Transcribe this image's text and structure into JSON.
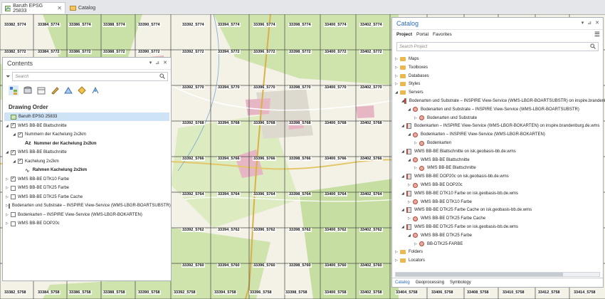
{
  "tabs": [
    {
      "label": "Baruth EPSG 25833",
      "active": true,
      "closable": true
    },
    {
      "label": "Catalog",
      "active": false,
      "closable": false
    }
  ],
  "map": {
    "tile_labels": [
      "33382_5774",
      "33384_5774",
      "33386_5774",
      "33388_5774",
      "33390_5774",
      "33392_5774",
      "33394_5774",
      "33396_5774",
      "33398_5774",
      "33400_5774",
      "33402_5774",
      "33382_5772",
      "33384_5772",
      "33386_5772",
      "33388_5772",
      "33390_5772",
      "33392_5772",
      "33394_5772",
      "33396_5772",
      "33398_5772",
      "33400_5772",
      "33402_5772",
      "33392_5770",
      "33394_5770",
      "33396_5770",
      "33398_5770",
      "33400_5770",
      "33402_5770",
      "33392_5768",
      "33394_5768",
      "33396_5768",
      "33398_5768",
      "33400_5768",
      "33402_5768",
      "33392_5766",
      "33394_5766",
      "33396_5766",
      "33398_5766",
      "33400_5766",
      "33402_5766",
      "33392_5764",
      "33394_5764",
      "33396_5764",
      "33398_5764",
      "33400_5764",
      "33402_5764",
      "33392_5762",
      "33394_5762",
      "33396_5762",
      "33398_5762",
      "33400_5762",
      "33402_5762",
      "33392_5760",
      "33394_5760",
      "33396_5760",
      "33398_5760",
      "33400_5760",
      "33402_5760",
      "33382_5758",
      "33384_5758",
      "33386_5758",
      "33388_5758",
      "33390_5758",
      "33392_5758",
      "33394_5758",
      "33396_5758",
      "33398_5758",
      "33400_5758",
      "33402_5758",
      "33404_5758",
      "33406_5758",
      "33408_5758",
      "33410_5758",
      "33412_5758",
      "33414_5758"
    ]
  },
  "contents": {
    "title": "Contents",
    "search_placeholder": "Search",
    "section": "Drawing Order",
    "items": [
      {
        "label": "Baruth EPSG 25833",
        "level": 0,
        "checkbox": "map",
        "expander": "",
        "selected": true
      },
      {
        "label": "WMS BB-BE Blattschnitte",
        "level": 0,
        "checkbox": "checked",
        "expander": "open"
      },
      {
        "label": "Nummern der Kachelung 2x2km",
        "level": 1,
        "checkbox": "checked",
        "expander": "open"
      },
      {
        "label": "Nummer der Kachelung 2x2km",
        "level": 2,
        "checkbox": "none",
        "expander": "",
        "symbol": "text"
      },
      {
        "label": "WMS BB-BE Blattschnitte",
        "level": 0,
        "checkbox": "checked",
        "expander": "open"
      },
      {
        "label": "Kachelung 2x2km",
        "level": 1,
        "checkbox": "checked",
        "expander": "open"
      },
      {
        "label": "Rahmen Kachelung 2x2km",
        "level": 2,
        "checkbox": "none",
        "expander": "",
        "symbol": "line"
      },
      {
        "label": "WMS BB-BE DTK10 Farbe",
        "level": 0,
        "checkbox": "checked",
        "expander": "closed"
      },
      {
        "label": "WMS BB-BE DTK25 Farbe",
        "level": 0,
        "checkbox": "unchecked",
        "expander": "closed"
      },
      {
        "label": "WMS BB-BE DTK25 Farbe Cache",
        "level": 0,
        "checkbox": "unchecked",
        "expander": "closed"
      },
      {
        "label": "Bodenarten und Substrate – INSPIRE View-Service (WMS-LBGR-BOARTSUBSTR)",
        "level": 0,
        "checkbox": "unchecked",
        "expander": "closed"
      },
      {
        "label": "Bodenkarten – INSPIRE View-Service (WMS-LBGR-BOKARTEN)",
        "level": 0,
        "checkbox": "unchecked",
        "expander": "closed"
      },
      {
        "label": "WMS BB-BE DOP20c",
        "level": 0,
        "checkbox": "unchecked",
        "expander": "closed"
      }
    ]
  },
  "catalog": {
    "title": "Catalog",
    "tabs": [
      "Project",
      "Portal",
      "Favorites"
    ],
    "search_placeholder": "Search Project",
    "bottom_tabs": [
      "Catalog",
      "Geoprocessing",
      "Symbology"
    ],
    "items": [
      {
        "label": "Maps",
        "level": 0,
        "expander": "closed",
        "icon": "folder"
      },
      {
        "label": "Toolboxes",
        "level": 0,
        "expander": "closed",
        "icon": "folder"
      },
      {
        "label": "Databases",
        "level": 0,
        "expander": "closed",
        "icon": "folder"
      },
      {
        "label": "Styles",
        "level": 0,
        "expander": "closed",
        "icon": "folder"
      },
      {
        "label": "Servers",
        "level": 0,
        "expander": "open",
        "icon": "folder"
      },
      {
        "label": "Bodenarten und Substrate – INSPIRE View-Service (WMS-LBGR-BOARTSUBSTR) on inspire.brandenburg.de.wms",
        "level": 1,
        "expander": "open",
        "icon": "server"
      },
      {
        "label": "Bodenarten und Substrate – INSPIRE View-Service (WMS-LBGR-BOARTSUBSTR)",
        "level": 2,
        "expander": "open",
        "icon": "layer"
      },
      {
        "label": "Bodenarten und Substrate",
        "level": 3,
        "expander": "closed",
        "icon": "layer"
      },
      {
        "label": "Bodenkarten – INSPIRE View-Service (WMS-LBGR-BOKARTEN) on inspire.brandenburg.de.wms",
        "level": 1,
        "expander": "open",
        "icon": "server"
      },
      {
        "label": "Bodenkarten – INSPIRE View-Service (WMS-LBGR-BOKARTEN)",
        "level": 2,
        "expander": "open",
        "icon": "layer"
      },
      {
        "label": "Bodenkarten",
        "level": 3,
        "expander": "closed",
        "icon": "layer"
      },
      {
        "label": "WMS BB-BE Blattschnitte on isk.geobasis-bb.de.wms",
        "level": 1,
        "expander": "open",
        "icon": "server"
      },
      {
        "label": "WMS BB-BE Blattschnitte",
        "level": 2,
        "expander": "open",
        "icon": "layer"
      },
      {
        "label": "WMS BB-BE Blattschnitte",
        "level": 3,
        "expander": "closed",
        "icon": "layer"
      },
      {
        "label": "WMS BB-BE DOP20c on isk.geobasis-bb.de.wms",
        "level": 1,
        "expander": "open",
        "icon": "server"
      },
      {
        "label": "WMS BB-BE DOP20c",
        "level": 2,
        "expander": "closed",
        "icon": "layer"
      },
      {
        "label": "WMS BB-BE DTK10 Farbe on isk.geobasis-bb.de.wms",
        "level": 1,
        "expander": "open",
        "icon": "server"
      },
      {
        "label": "WMS BB-BE DTK10 Farbe",
        "level": 2,
        "expander": "closed",
        "icon": "layer"
      },
      {
        "label": "WMS BB-BE DTK25 Farbe Cache on isk.geobasis-bb.de.wms",
        "level": 1,
        "expander": "open",
        "icon": "server"
      },
      {
        "label": "WMS BB-BE DTK25 Farbe Cache",
        "level": 2,
        "expander": "closed",
        "icon": "layer"
      },
      {
        "label": "WMS BB-BE DTK25 Farbe on isk.geobasis-bb.de.wms",
        "level": 1,
        "expander": "open",
        "icon": "server"
      },
      {
        "label": "WMS BB-BE DTK25 Farbe",
        "level": 2,
        "expander": "open",
        "icon": "layer"
      },
      {
        "label": "BB-DTK25-FARBE",
        "level": 3,
        "expander": "closed",
        "icon": "layer"
      },
      {
        "label": "Folders",
        "level": 0,
        "expander": "closed",
        "icon": "folder"
      },
      {
        "label": "Locators",
        "level": 0,
        "expander": "closed",
        "icon": "folder"
      }
    ]
  }
}
